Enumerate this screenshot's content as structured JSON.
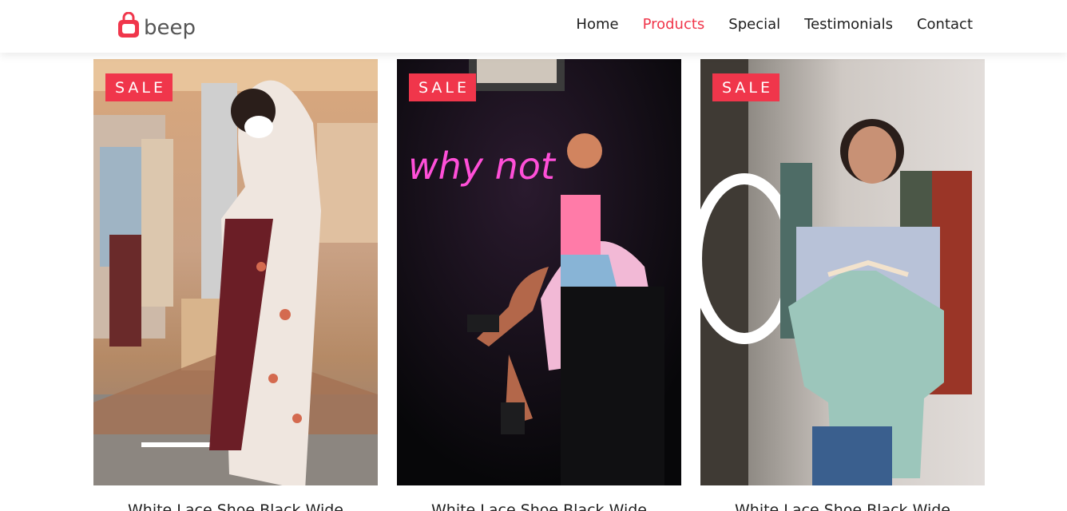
{
  "brand": {
    "name": "beep",
    "accent": "#f0364b"
  },
  "nav": {
    "items": [
      {
        "label": "Home",
        "active": false
      },
      {
        "label": "Products",
        "active": true
      },
      {
        "label": "Special",
        "active": false
      },
      {
        "label": "Testimonials",
        "active": false
      },
      {
        "label": "Contact",
        "active": false
      }
    ]
  },
  "products": [
    {
      "badge": "SALE",
      "title": "White Lace Shoe Black Wide",
      "photo": "woman in floral dress holding skirt in clothing store"
    },
    {
      "badge": "SALE",
      "title": "White Lace Shoe Black Wide",
      "photo": "woman sitting under neon why not sign",
      "neon_text": "why not"
    },
    {
      "badge": "SALE",
      "title": "White Lace Shoe Black Wide",
      "photo": "woman holding mint long sleeve top on hanger"
    }
  ]
}
